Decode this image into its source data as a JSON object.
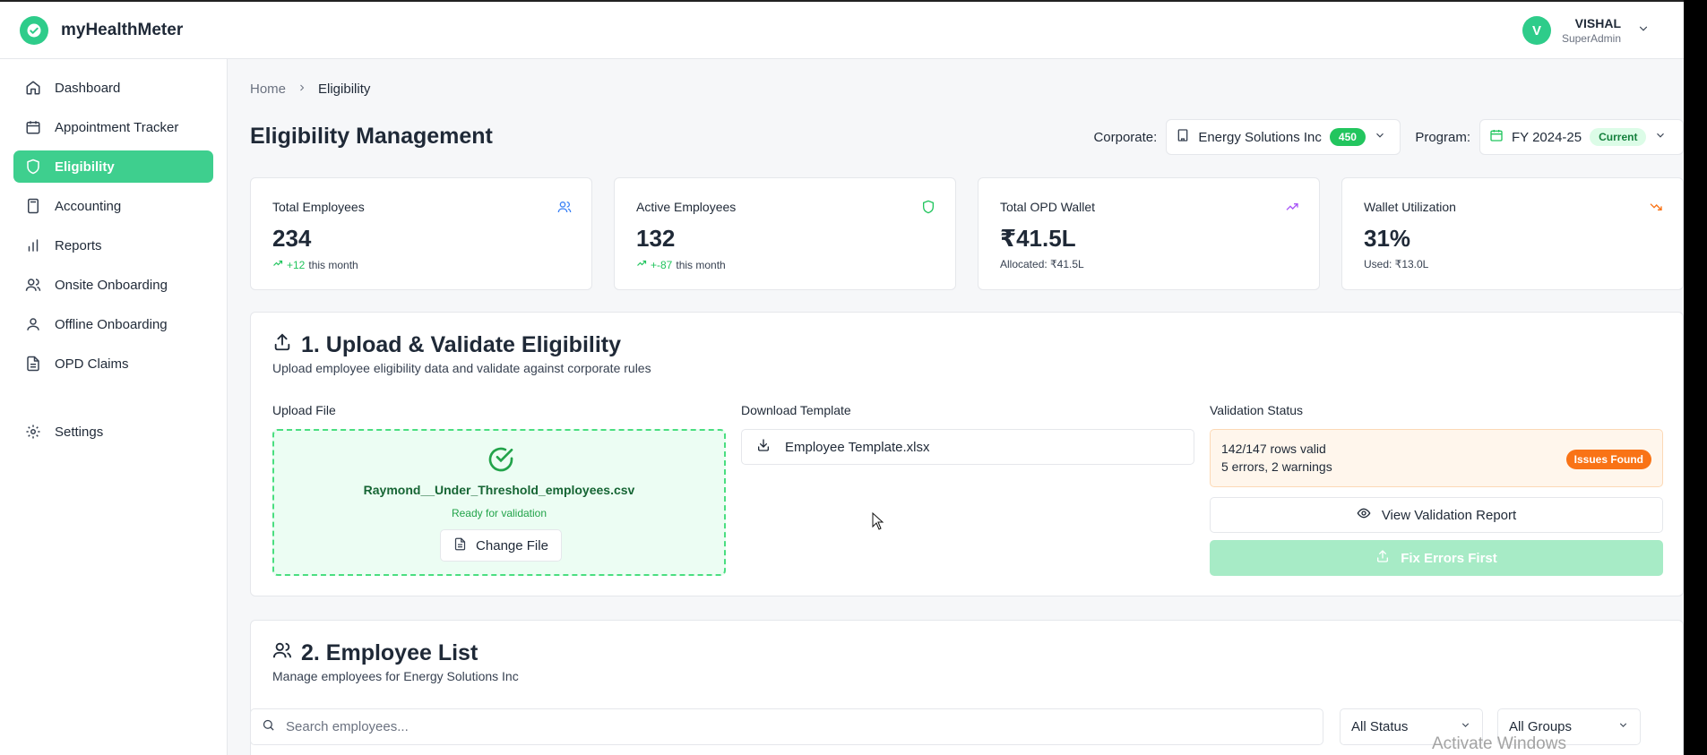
{
  "app": {
    "name": "myHealthMeter"
  },
  "user": {
    "initial": "V",
    "name": "VISHAL",
    "role": "SuperAdmin"
  },
  "sidebar": {
    "items": [
      {
        "label": "Dashboard",
        "icon": "home-icon"
      },
      {
        "label": "Appointment Tracker",
        "icon": "calendar-icon"
      },
      {
        "label": "Eligibility",
        "icon": "shield-icon",
        "active": true
      },
      {
        "label": "Accounting",
        "icon": "calculator-icon"
      },
      {
        "label": "Reports",
        "icon": "bar-chart-icon"
      },
      {
        "label": "Onsite Onboarding",
        "icon": "users-icon"
      },
      {
        "label": "Offline Onboarding",
        "icon": "user-icon"
      },
      {
        "label": "OPD Claims",
        "icon": "file-icon"
      },
      {
        "label": "Settings",
        "icon": "gear-icon"
      }
    ]
  },
  "breadcrumb": {
    "home": "Home",
    "current": "Eligibility"
  },
  "page": {
    "title": "Eligibility Management"
  },
  "filters": {
    "corporate_label": "Corporate:",
    "corporate_value": "Energy Solutions Inc",
    "corporate_count": "450",
    "program_label": "Program:",
    "program_value": "FY 2024-25",
    "program_badge": "Current"
  },
  "stats": [
    {
      "title": "Total Employees",
      "value": "234",
      "delta": "+12",
      "suffix": "this month",
      "icon": "users-icon",
      "icon_color": "#3b82f6"
    },
    {
      "title": "Active Employees",
      "value": "132",
      "delta": "+-87",
      "suffix": "this month",
      "icon": "shield-icon",
      "icon_color": "#22c55e"
    },
    {
      "title": "Total OPD Wallet",
      "value": "₹41.5L",
      "note": "Allocated: ₹41.5L",
      "icon": "trending-up-icon",
      "icon_color": "#a855f7"
    },
    {
      "title": "Wallet Utilization",
      "value": "31%",
      "note": "Used: ₹13.0L",
      "icon": "trending-down-icon",
      "icon_color": "#f97316"
    }
  ],
  "upload": {
    "title": "1. Upload & Validate Eligibility",
    "subtitle": "Upload employee eligibility data and validate against corporate rules",
    "upload_label": "Upload File",
    "file_name": "Raymond__Under_Threshold_employees.csv",
    "file_status": "Ready for validation",
    "change_button": "Change File",
    "template_label": "Download Template",
    "template_button": "Employee Template.xlsx",
    "validation_label": "Validation Status",
    "validation_rows": "142/147 rows valid",
    "validation_detail": "5 errors, 2 warnings",
    "issues_badge": "Issues Found",
    "view_report_button": "View Validation Report",
    "fix_button": "Fix Errors First"
  },
  "employees": {
    "title": "2. Employee List",
    "subtitle": "Manage employees for Energy Solutions Inc",
    "search_placeholder": "Search employees...",
    "status_filter": "All Status",
    "group_filter": "All Groups"
  },
  "watermark": "Activate Windows",
  "colors": {
    "accent": "#3ecf8e",
    "warning": "#f97316"
  }
}
